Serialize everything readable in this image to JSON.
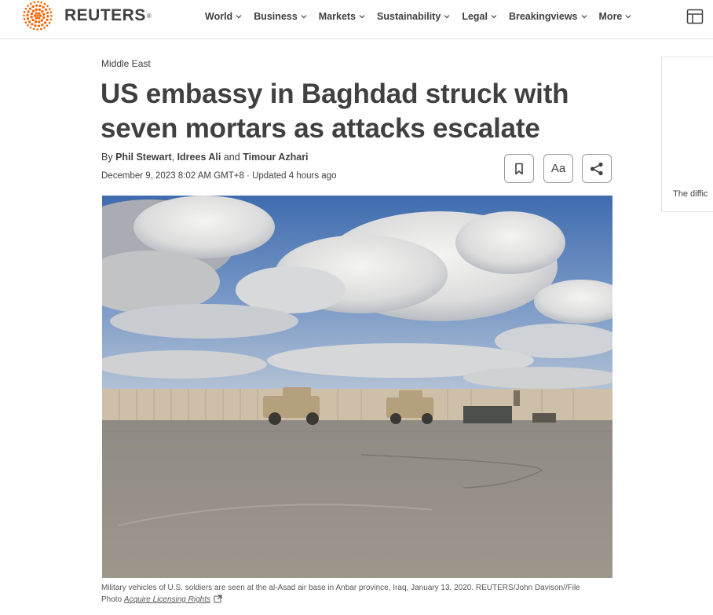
{
  "header": {
    "logo_text": "REUTERS",
    "logo_mark": "®",
    "nav": [
      {
        "label": "World"
      },
      {
        "label": "Business"
      },
      {
        "label": "Markets"
      },
      {
        "label": "Sustainability"
      },
      {
        "label": "Legal"
      },
      {
        "label": "Breakingviews"
      },
      {
        "label": "More"
      }
    ],
    "menu_icon": "layout-grid-icon",
    "brand_color": "#fa6400"
  },
  "article": {
    "section": "Middle East",
    "headline_line1": "US embassy in Baghdad struck with",
    "headline_line2": "seven mortars as attacks escalate",
    "byline": {
      "prefix": "By ",
      "authors": [
        "Phil Stewart",
        "Idrees Ali",
        "Timour Azhari"
      ],
      "sep1": ", ",
      "sep2": " and "
    },
    "date": "December 9, 2023 8:02 AM GMT+8 · Updated 4 hours ago",
    "tools": {
      "bookmark_icon": "bookmark-icon",
      "text_size_label": "Aa",
      "share_icon": "share-icon"
    },
    "photo": {
      "caption_line1": "Military vehicles of U.S. soldiers are seen at the al-Asad air base in Anbar province, Iraq, January 13, 2020. REUTERS/John Davison//File",
      "caption_prefix": "Photo ",
      "license_link": "Acquire Licensing Rights",
      "license_icon": "external-link-icon"
    }
  },
  "sidebar": {
    "ad_text": "The diffic"
  }
}
